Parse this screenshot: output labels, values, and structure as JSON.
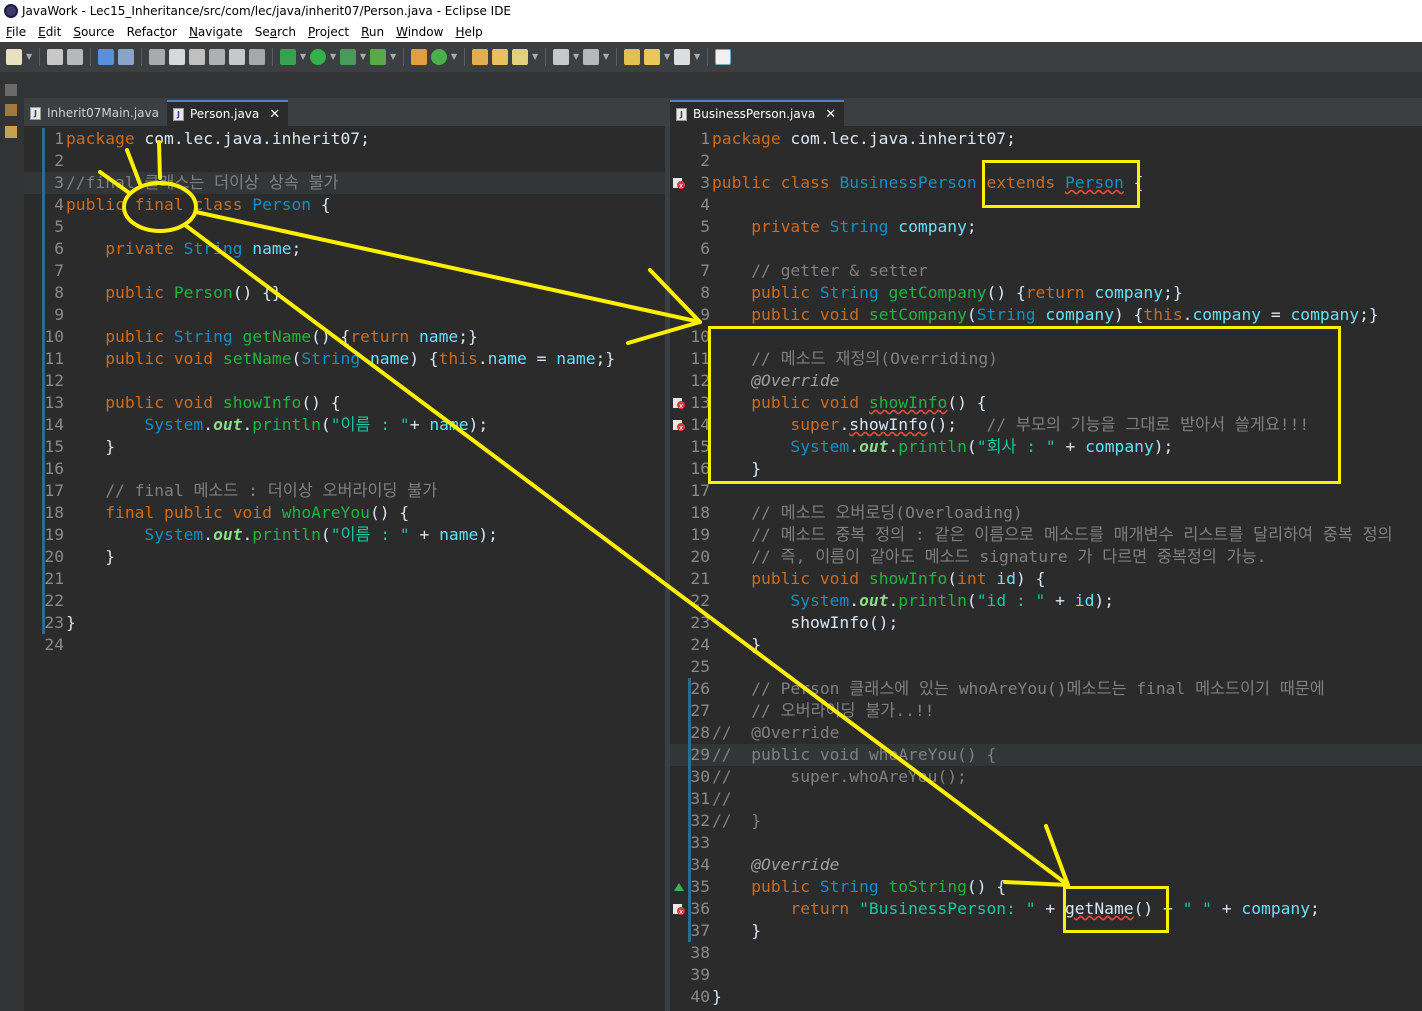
{
  "window": {
    "title": "JavaWork - Lec15_Inheritance/src/com/lec/java/inherit07/Person.java - Eclipse IDE"
  },
  "menu": [
    {
      "key": "F",
      "rest": "ile"
    },
    {
      "key": "E",
      "rest": "dit"
    },
    {
      "key": "S",
      "rest": "ource"
    },
    {
      "key": "",
      "rest": "Refac",
      "key2": "t",
      "rest2": "or"
    },
    {
      "key": "N",
      "rest": "avigate"
    },
    {
      "key": "",
      "rest": "Se",
      "key2": "a",
      "rest2": "rch"
    },
    {
      "key": "P",
      "rest": "roject"
    },
    {
      "key": "R",
      "rest": "un"
    },
    {
      "key": "W",
      "rest": "indow"
    },
    {
      "key": "H",
      "rest": "elp"
    }
  ],
  "left_editor": {
    "tabs": [
      {
        "label": "Inherit07Main.java",
        "active": false
      },
      {
        "label": "Person.java",
        "active": true
      }
    ]
  },
  "right_editor": {
    "tabs": [
      {
        "label": "BusinessPerson.java",
        "active": true
      }
    ]
  },
  "annotation_color": "#ffef00",
  "left_code": [
    {
      "n": "1",
      "html": "<span class='k'>package</span> com.lec.java.inherit07;"
    },
    {
      "n": "2",
      "html": ""
    },
    {
      "n": "3",
      "html": "<span class='c'>//final 클래스는 더이상 상속 불가</span>",
      "hl": true
    },
    {
      "n": "4",
      "html": "<span class='k'>public</span> <span class='k'>final</span> <span class='k'>class</span> <span class='t'>Person</span> {"
    },
    {
      "n": "5",
      "html": ""
    },
    {
      "n": "6",
      "html": "    <span class='k'>private</span> <span class='t'>String</span> <span class='f'>name</span>;"
    },
    {
      "n": "7",
      "html": ""
    },
    {
      "n": "8",
      "html": "    <span class='k'>public</span> <span class='m'>Person</span>() {}"
    },
    {
      "n": "9",
      "html": ""
    },
    {
      "n": "10",
      "html": "    <span class='k'>public</span> <span class='t'>String</span> <span class='m'>getName</span>() {<span class='k'>return</span> <span class='f'>name</span>;}"
    },
    {
      "n": "11",
      "html": "    <span class='k'>public</span> <span class='k'>void</span> <span class='m'>setName</span>(<span class='t'>String</span> <span class='f'>name</span>) {<span class='k'>this</span>.<span class='f'>name</span> = <span class='f'>name</span>;}"
    },
    {
      "n": "12",
      "html": ""
    },
    {
      "n": "13",
      "html": "    <span class='k'>public</span> <span class='k'>void</span> <span class='m'>showInfo</span>() {"
    },
    {
      "n": "14",
      "html": "        <span class='t'>System</span>.<span class='sv'>out</span>.<span class='m'>println</span>(<span class='s'>\"이름 : \"</span>+ <span class='f'>name</span>);"
    },
    {
      "n": "15",
      "html": "    }"
    },
    {
      "n": "16",
      "html": ""
    },
    {
      "n": "17",
      "html": "    <span class='c'>// final 메소드 : 더이상 오버라이딩 불가</span>"
    },
    {
      "n": "18",
      "html": "    <span class='k'>final</span> <span class='k'>public</span> <span class='k'>void</span> <span class='m'>whoAreYou</span>() {"
    },
    {
      "n": "19",
      "html": "        <span class='t'>System</span>.<span class='sv'>out</span>.<span class='m'>println</span>(<span class='s'>\"이름 : \"</span> + <span class='f'>name</span>);"
    },
    {
      "n": "20",
      "html": "    }"
    },
    {
      "n": "21",
      "html": ""
    },
    {
      "n": "22",
      "html": ""
    },
    {
      "n": "23",
      "html": "}"
    },
    {
      "n": "24",
      "html": "",
      "nobar": true
    }
  ],
  "right_code": [
    {
      "n": "1",
      "html": "<span class='k'>package</span> com.lec.java.inherit07;"
    },
    {
      "n": "2",
      "html": ""
    },
    {
      "n": "3",
      "html": "<span class='k'>public</span> <span class='k'>class</span> <span class='t'>BusinessPerson</span> <span class='k'>extends</span> <span class='t err'>Person</span> {",
      "err": true
    },
    {
      "n": "4",
      "html": ""
    },
    {
      "n": "5",
      "html": "    <span class='k'>private</span> <span class='t'>String</span> <span class='f'>company</span>;"
    },
    {
      "n": "6",
      "html": ""
    },
    {
      "n": "7",
      "html": "    <span class='c'>// getter &amp; setter</span>"
    },
    {
      "n": "8",
      "html": "    <span class='k'>public</span> <span class='t'>String</span> <span class='m'>getCompany</span>() {<span class='k'>return</span> <span class='f'>company</span>;}"
    },
    {
      "n": "9",
      "html": "    <span class='k'>public</span> <span class='k'>void</span> <span class='m'>setCompany</span>(<span class='t'>String</span> <span class='f'>company</span>) {<span class='k'>this</span>.<span class='f'>company</span> = <span class='f'>company</span>;}"
    },
    {
      "n": "10",
      "html": ""
    },
    {
      "n": "11",
      "html": "    <span class='c'>// 메소드 재정의(Overriding)</span>"
    },
    {
      "n": "12",
      "html": "    <span class='a'>@Override</span>"
    },
    {
      "n": "13",
      "html": "    <span class='k'>public</span> <span class='k'>void</span> <span class='m err'>showInfo</span>() {",
      "err": true
    },
    {
      "n": "14",
      "html": "        <span class='k'>super</span>.<span class='n err'>showInfo</span>();   <span class='c'>// 부모의 기능을 그대로 받아서 쓸게요!!!</span>",
      "err": true
    },
    {
      "n": "15",
      "html": "        <span class='t'>System</span>.<span class='sv'>out</span>.<span class='m'>println</span>(<span class='s'>\"회사 : \"</span> + <span class='f'>company</span>);"
    },
    {
      "n": "16",
      "html": "    }"
    },
    {
      "n": "17",
      "html": ""
    },
    {
      "n": "18",
      "html": "    <span class='c'>// 메소드 오버로딩(Overloading)</span>"
    },
    {
      "n": "19",
      "html": "    <span class='c'>// 메소드 중복 정의 : 같은 이름으로 메소드를 매개변수 리스트를 달리하여 중복 정의</span>"
    },
    {
      "n": "20",
      "html": "    <span class='c'>// 즉, 이름이 같아도 메소드 signature 가 다르면 중복정의 가능.</span>"
    },
    {
      "n": "21",
      "html": "    <span class='k'>public</span> <span class='k'>void</span> <span class='m'>showInfo</span>(<span class='k'>int</span> <span class='f'>id</span>) {"
    },
    {
      "n": "22",
      "html": "        <span class='t'>System</span>.<span class='sv'>out</span>.<span class='m'>println</span>(<span class='s'>\"id : \"</span> + <span class='f'>id</span>);"
    },
    {
      "n": "23",
      "html": "        <span class='n'>showInfo</span>();"
    },
    {
      "n": "24",
      "html": "    }"
    },
    {
      "n": "25",
      "html": ""
    },
    {
      "n": "26",
      "html": "    <span class='c'>// Person 클래스에 있는 whoAreYou()메소드는 final 메소드이기 때문에</span>",
      "bar": true
    },
    {
      "n": "27",
      "html": "    <span class='c'>// 오버라이딩 불가..!!</span>",
      "bar": true
    },
    {
      "n": "28",
      "html": "<span class='c'>//  @Override</span>",
      "bar": true
    },
    {
      "n": "29",
      "html": "<span class='c'>//  public void whoAreYou() {</span>",
      "bar": true,
      "hl": true
    },
    {
      "n": "30",
      "html": "<span class='c'>//      super.whoAreYou();</span>",
      "bar": true
    },
    {
      "n": "31",
      "html": "<span class='c'>//</span>",
      "bar": true
    },
    {
      "n": "32",
      "html": "<span class='c'>//  }</span>",
      "bar": true
    },
    {
      "n": "33",
      "html": "",
      "bar": true
    },
    {
      "n": "34",
      "html": "    <span class='a'>@Override</span>",
      "bar": true
    },
    {
      "n": "35",
      "html": "    <span class='k'>public</span> <span class='t'>String</span> <span class='m'>toString</span>() {",
      "bar": true,
      "ov": true
    },
    {
      "n": "36",
      "html": "        <span class='k'>return</span> <span class='s'>\"BusinessPerson: \"</span> + <span class='n err'>getName</span>() + <span class='s'>\" \"</span> + <span class='f'>company</span>;",
      "bar": true,
      "err": true
    },
    {
      "n": "37",
      "html": "    }",
      "bar": true
    },
    {
      "n": "38",
      "html": ""
    },
    {
      "n": "39",
      "html": ""
    },
    {
      "n": "40",
      "html": "}"
    }
  ]
}
